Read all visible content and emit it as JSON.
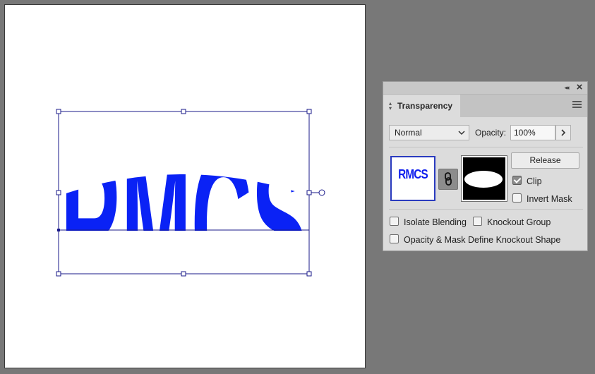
{
  "artboard": {
    "art_text": "RMCS",
    "art_color": "#0a22f5",
    "selection_color": "#1a1a8a"
  },
  "panel": {
    "tab_title": "Transparency",
    "blend_mode": "Normal",
    "opacity_label": "Opacity:",
    "opacity_value": "100%",
    "thumbnail_text": "RMCS",
    "release_label": "Release",
    "clip_label": "Clip",
    "clip_checked": true,
    "invert_mask_label": "Invert Mask",
    "invert_mask_checked": false,
    "isolate_blending_label": "Isolate Blending",
    "knockout_group_label": "Knockout Group",
    "opacity_mask_label": "Opacity & Mask Define Knockout Shape"
  },
  "colors": {
    "canvas_bg": "#787878",
    "panel_bg": "#dcdcdc",
    "accent_blue": "#0a22f5"
  }
}
